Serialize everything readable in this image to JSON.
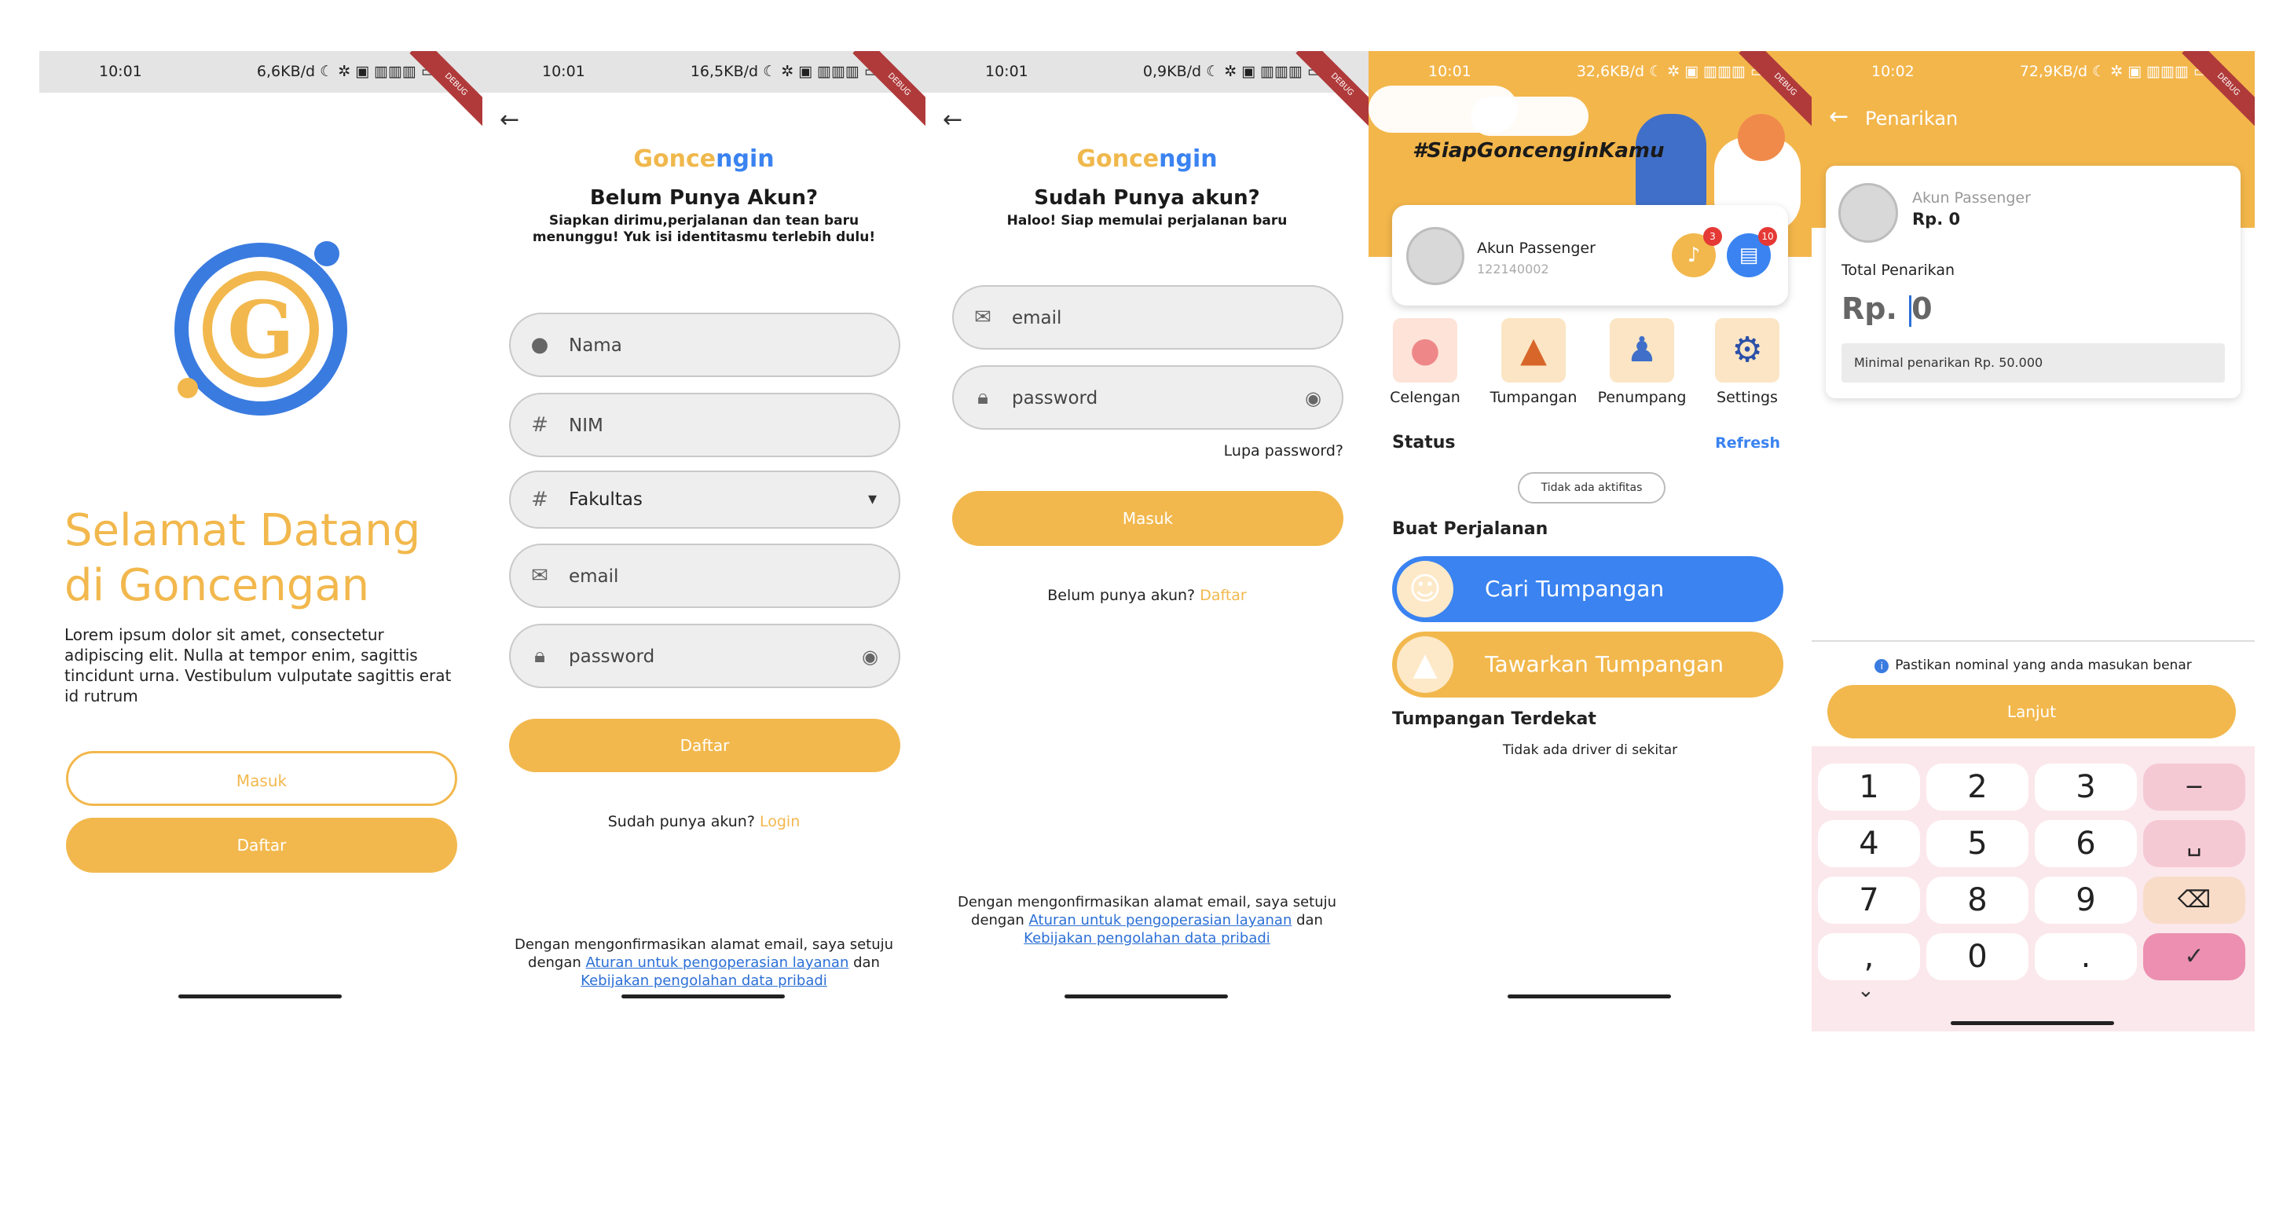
{
  "status": [
    {
      "time": "10:01",
      "right": "6,6KB/d ☾ ✲ ▣ ▥▥▥ ▭",
      "debug": "DEBUG"
    },
    {
      "time": "10:01",
      "right": "16,5KB/d ☾ ✲ ▣ ▥▥▥ ▭",
      "debug": "DEBUG"
    },
    {
      "time": "10:01",
      "right": "0,9KB/d ☾ ✲ ▣ ▥▥▥ ▭",
      "debug": "DEBUG"
    },
    {
      "time": "10:01",
      "right": "32,6KB/d ☾ ✲ ▣ ▥▥▥ ▭",
      "debug": "DEBUG"
    },
    {
      "time": "10:02",
      "right": "72,9KB/d ☾ ✲ ▣ ▥▥▥ ▭",
      "debug": "DEBUG"
    }
  ],
  "colors": {
    "primary": "#f2b84d",
    "blue": "#3a83f1",
    "link": "#2b6fd6"
  },
  "welcome": {
    "title": "Selamat Datang di Goncengan",
    "body": "Lorem ipsum dolor sit amet, consectetur adipiscing elit. Nulla at tempor enim, sagittis tincidunt urna. Vestibulum vulputate sagittis erat id rutrum",
    "login": "Masuk",
    "register": "Daftar"
  },
  "brand": {
    "part1": "Gonce",
    "part2": "ngin"
  },
  "register": {
    "title": "Belum Punya Akun?",
    "subtitle": "Siapkan dirimu,perjalanan dan tean baru menunggu! Yuk isi identitasmu terlebih dulu!",
    "name_ph": "Nama",
    "nim_ph": "NIM",
    "faculty": "Fakultas",
    "email_ph": "email",
    "password_ph": "password",
    "submit": "Daftar",
    "have_account": "Sudah punya akun?",
    "login_link": "Login"
  },
  "login": {
    "title": "Sudah Punya akun?",
    "subtitle": "Haloo! Siap memulai perjalanan baru",
    "email_ph": "email",
    "password_ph": "password",
    "forgot": "Lupa password?",
    "submit": "Masuk",
    "no_account": "Belum punya akun?",
    "register_link": "Daftar"
  },
  "terms": {
    "prefix": "Dengan mengonfirmasikan alamat email, saya setuju dengan",
    "link1": "Aturan untuk pengoperasian layanan",
    "mid": "dan",
    "link2": "Kebijakan pengolahan data pribadi"
  },
  "home": {
    "hashtag": "#SiapGoncenginKamu",
    "user_name": "Akun Passenger",
    "user_id": "122140002",
    "notif_count": "3",
    "chat_count": "10",
    "menu": [
      "Celengan",
      "Tumpangan",
      "Penumpang",
      "Settings"
    ],
    "status_label": "Status",
    "refresh": "Refresh",
    "status_value": "Tidak ada aktifitas",
    "trip_label": "Buat Perjalanan",
    "find_ride": "Cari Tumpangan",
    "offer_ride": "Tawarkan Tumpangan",
    "nearby_label": "Tumpangan Terdekat",
    "nearby_empty": "Tidak ada driver di sekitar"
  },
  "withdraw": {
    "title": "Penarikan",
    "account": "Akun Passenger",
    "balance": "Rp. 0",
    "total_label": "Total Penarikan",
    "currency": "Rp.",
    "amount": "0",
    "min_note": "Minimal penarikan Rp. 50.000",
    "hint": "Pastikan nominal yang anda masukan benar",
    "next": "Lanjut",
    "keys": [
      "1",
      "2",
      "3",
      "−",
      "4",
      "5",
      "6",
      "␣",
      "7",
      "8",
      "9",
      "⌫",
      ",",
      "0",
      ".",
      "✓"
    ],
    "collapse": "⌄"
  }
}
